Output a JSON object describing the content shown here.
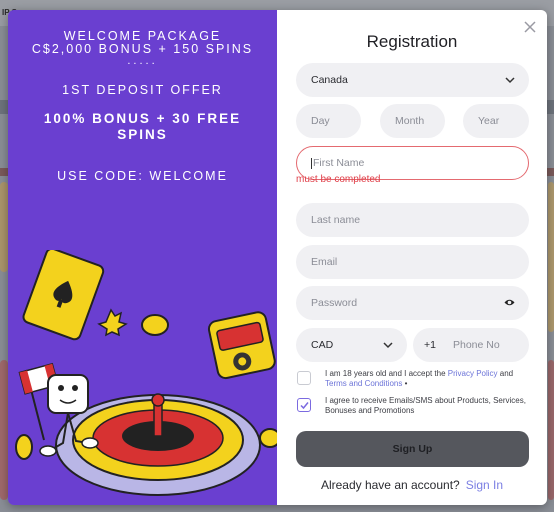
{
  "background": {
    "top_text": "IP S"
  },
  "promo": {
    "line1": "WELCOME PACKAGE",
    "line2": "C$2,000 BONUS + 150 SPINS",
    "dots": ".....",
    "offer": "1ST DEPOSIT OFFER",
    "bonus": "100% BONUS + 30 FREE SPINS",
    "code": "USE CODE: WELCOME"
  },
  "form": {
    "title": "Registration",
    "country": "Canada",
    "day_placeholder": "Day",
    "month_placeholder": "Month",
    "year_placeholder": "Year",
    "first_name_placeholder": "First Name",
    "first_name_error": "must be completed",
    "last_name_placeholder": "Last name",
    "email_placeholder": "Email",
    "password_placeholder": "Password",
    "currency": "CAD",
    "phone_code": "+1",
    "phone_placeholder": "Phone No",
    "age_consent_prefix": "I am 18 years old and I accept the ",
    "privacy_link": "Privacy Policy",
    "and_text": " and ",
    "terms_link": "Terms and Conditions",
    "terms_suffix": " •",
    "marketing_consent": "I agree to receive Emails/SMS about Products, Services, Bonuses and Promotions",
    "submit_label": "Sign Up",
    "footer_text": "Already have an account?",
    "signin_link": "Sign In"
  },
  "colors": {
    "promo_bg": "#6a3fd0",
    "error": "#e0404a",
    "link": "#7b7fe3",
    "button": "#55575d"
  },
  "icons": [
    "close-icon",
    "chevron-down-icon",
    "eye-icon",
    "checkmark-icon"
  ]
}
